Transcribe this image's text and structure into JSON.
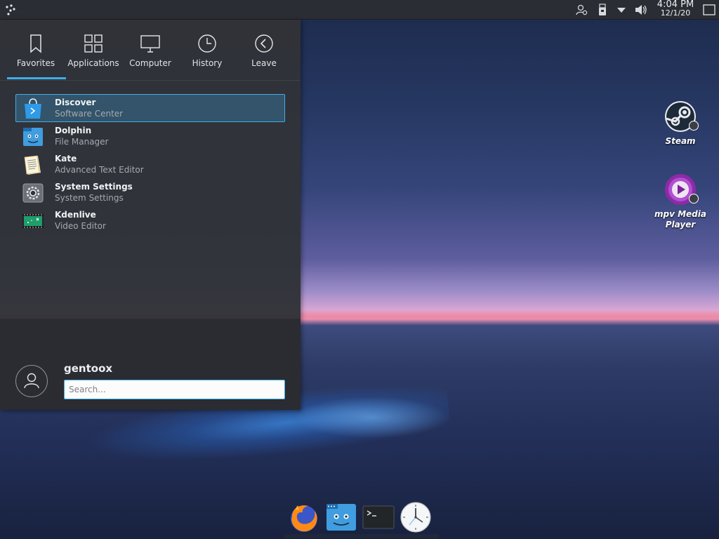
{
  "panel": {
    "time": "4:04 PM",
    "date": "12/1/20",
    "tray_icons": [
      "user-switch-icon",
      "usb-drive-icon",
      "tray-expander-icon",
      "volume-icon",
      "show-desktop-icon"
    ]
  },
  "launcher": {
    "tabs": [
      {
        "label": "Favorites",
        "icon": "bookmark-icon",
        "active": true
      },
      {
        "label": "Applications",
        "icon": "grid-icon",
        "active": false
      },
      {
        "label": "Computer",
        "icon": "monitor-icon",
        "active": false
      },
      {
        "label": "History",
        "icon": "clock-icon",
        "active": false
      },
      {
        "label": "Leave",
        "icon": "back-arrow-icon",
        "active": false
      }
    ],
    "favorites": [
      {
        "name": "Discover",
        "description": "Software Center",
        "icon": "discover-icon",
        "selected": true
      },
      {
        "name": "Dolphin",
        "description": "File Manager",
        "icon": "dolphin-icon",
        "selected": false
      },
      {
        "name": "Kate",
        "description": "Advanced Text Editor",
        "icon": "kate-icon",
        "selected": false
      },
      {
        "name": "System Settings",
        "description": "System Settings",
        "icon": "settings-icon",
        "selected": false
      },
      {
        "name": "Kdenlive",
        "description": "Video Editor",
        "icon": "kdenlive-icon",
        "selected": false
      }
    ],
    "username": "gentoox",
    "search_placeholder": "Search..."
  },
  "desktop_icons": [
    {
      "label": "Steam",
      "icon": "steam-icon"
    },
    {
      "label": "mpv Media Player",
      "icon": "mpv-icon"
    }
  ],
  "dock": [
    {
      "icon": "firefox-icon"
    },
    {
      "icon": "file-manager-icon"
    },
    {
      "icon": "terminal-icon"
    },
    {
      "icon": "clock-app-icon"
    }
  ],
  "colors": {
    "accent": "#3daee9",
    "panel_bg": "#2a2d33",
    "launcher_bg": "#313338"
  }
}
